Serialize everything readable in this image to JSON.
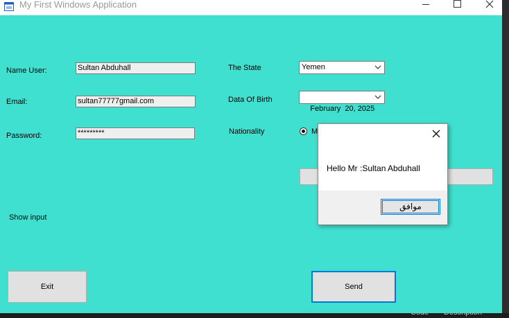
{
  "window": {
    "title": "My First Windows Application"
  },
  "form": {
    "name_label": "Name User:",
    "name_value": "Sultan Abduhall",
    "email_label": "Email:",
    "email_value": "sultan77777gmail.com",
    "password_label": "Password:",
    "password_value": "*********",
    "state_label": "The State",
    "state_value": "Yemen",
    "dob_label": "Data Of Birth",
    "dob_value": "February  20, 2025",
    "nationality_label": "Nationality",
    "nationality_option_partial": "M",
    "show_input_label": "Show input",
    "exit_button": "Exit",
    "send_button": "Send"
  },
  "dialog": {
    "message": "Hello Mr :Sultan Abduhall",
    "ok_button": "موافق"
  },
  "ide_background": {
    "code_label": "Code",
    "description_label": "Description"
  },
  "colors": {
    "form_background": "#40e0d0",
    "accent": "#0078d7"
  }
}
